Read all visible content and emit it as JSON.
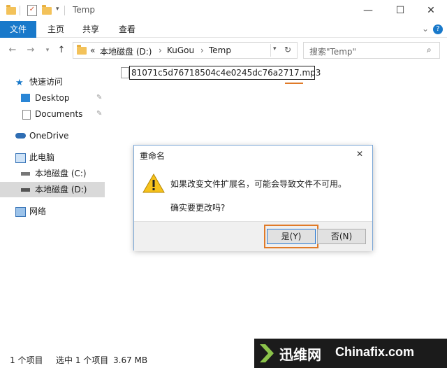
{
  "window": {
    "title": "Temp",
    "controls": {
      "minimize": "—",
      "maximize": "☐",
      "close": "✕"
    }
  },
  "ribbon": {
    "tabs": [
      "文件",
      "主页",
      "共享",
      "查看"
    ],
    "expand_icon": "⌄",
    "help_icon": "?"
  },
  "address": {
    "overflow": "«",
    "crumbs": [
      "本地磁盘 (D:)",
      "KuGou",
      "Temp"
    ],
    "search_placeholder": "搜索\"Temp\""
  },
  "sidebar": {
    "items": [
      {
        "label": "快速访问",
        "icon": "star-icon"
      },
      {
        "label": "Desktop",
        "icon": "desktop-icon"
      },
      {
        "label": "Documents",
        "icon": "documents-icon"
      },
      {
        "label": "OneDrive",
        "icon": "cloud-icon"
      },
      {
        "label": "此电脑",
        "icon": "computer-icon"
      },
      {
        "label": "本地磁盘 (C:)",
        "icon": "drive-icon"
      },
      {
        "label": "本地磁盘 (D:)",
        "icon": "drive-icon"
      },
      {
        "label": "网络",
        "icon": "network-icon"
      }
    ]
  },
  "file": {
    "rename_value": "81071c5d76718504c4e0245dc76a2717.mp3"
  },
  "dialog": {
    "title": "重命名",
    "message": "如果改变文件扩展名，可能会导致文件不可用。",
    "question": "确实要更改吗?",
    "yes_label": "是(Y)",
    "no_label": "否(N)",
    "close": "✕"
  },
  "status": {
    "count": "1 个项目",
    "selected": "选中 1 个项目",
    "size": "3.67 MB"
  },
  "watermark": {
    "left": "迅维网",
    "right": "Chinafix.com"
  }
}
